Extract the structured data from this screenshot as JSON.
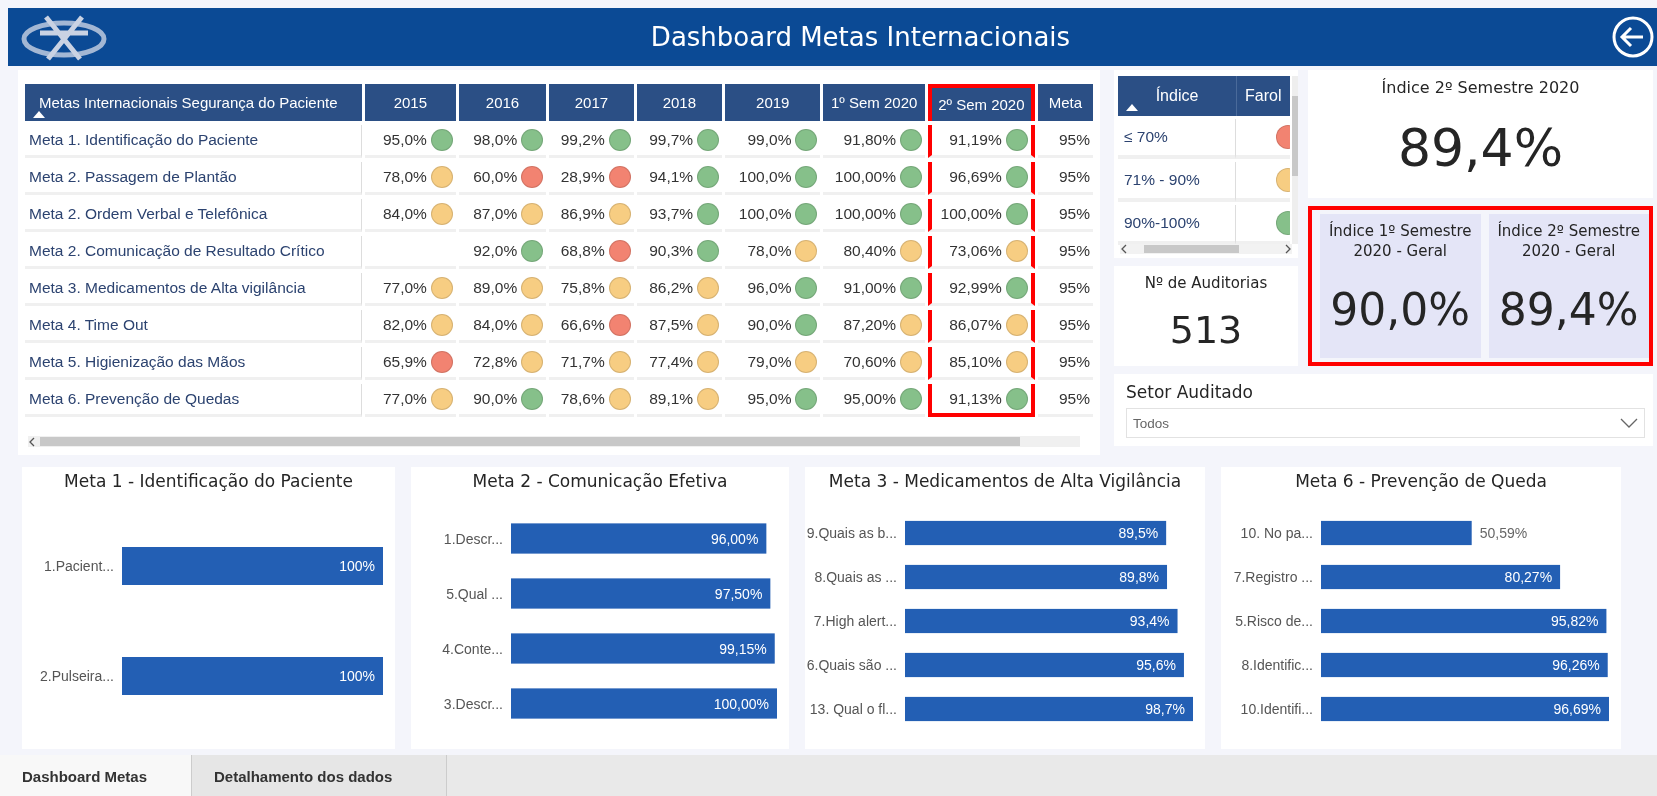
{
  "header": {
    "title": "Dashboard Metas Internacionais"
  },
  "table": {
    "columns": [
      {
        "label": "Metas Internacionais Segurança do Paciente",
        "highlighted": false
      },
      {
        "label": "2015",
        "highlighted": false
      },
      {
        "label": "2016",
        "highlighted": false
      },
      {
        "label": "2017",
        "highlighted": false
      },
      {
        "label": "2018",
        "highlighted": false
      },
      {
        "label": "2019",
        "highlighted": false
      },
      {
        "label": "1º Sem 2020",
        "highlighted": false
      },
      {
        "label": "2º Sem 2020",
        "highlighted": true
      },
      {
        "label": "Meta",
        "highlighted": false
      }
    ],
    "rows": [
      {
        "cells": [
          "Meta 1. Identificação do Paciente",
          {
            "value": "95,0%",
            "color": "#86c08a"
          },
          {
            "value": "98,0%",
            "color": "#86c08a"
          },
          {
            "value": "99,2%",
            "color": "#86c08a"
          },
          {
            "value": "99,7%",
            "color": "#86c08a"
          },
          {
            "value": "99,0%",
            "color": "#86c08a"
          },
          {
            "value": "91,80%",
            "color": "#86c08a"
          },
          {
            "value": "91,19%",
            "color": "#86c08a"
          },
          "95%"
        ]
      },
      {
        "cells": [
          "Meta 2. Passagem de Plantão",
          {
            "value": "78,0%",
            "color": "#f7cd82"
          },
          {
            "value": "60,0%",
            "color": "#f28371"
          },
          {
            "value": "28,9%",
            "color": "#f28371"
          },
          {
            "value": "94,1%",
            "color": "#86c08a"
          },
          {
            "value": "100,0%",
            "color": "#86c08a"
          },
          {
            "value": "100,00%",
            "color": "#86c08a"
          },
          {
            "value": "96,69%",
            "color": "#86c08a"
          },
          "95%"
        ]
      },
      {
        "cells": [
          "Meta 2. Ordem Verbal e Telefônica",
          {
            "value": "84,0%",
            "color": "#f7cd82"
          },
          {
            "value": "87,0%",
            "color": "#f7cd82"
          },
          {
            "value": "86,9%",
            "color": "#f7cd82"
          },
          {
            "value": "93,7%",
            "color": "#86c08a"
          },
          {
            "value": "100,0%",
            "color": "#86c08a"
          },
          {
            "value": "100,00%",
            "color": "#86c08a"
          },
          {
            "value": "100,00%",
            "color": "#86c08a"
          },
          "95%"
        ]
      },
      {
        "cells": [
          "Meta 2. Comunicação de Resultado Crítico",
          "",
          {
            "value": "92,0%",
            "color": "#86c08a"
          },
          {
            "value": "68,8%",
            "color": "#f28371"
          },
          {
            "value": "90,3%",
            "color": "#86c08a"
          },
          {
            "value": "78,0%",
            "color": "#f7cd82"
          },
          {
            "value": "80,40%",
            "color": "#f7cd82"
          },
          {
            "value": "73,06%",
            "color": "#f7cd82"
          },
          "95%"
        ]
      },
      {
        "cells": [
          "Meta 3. Medicamentos de Alta vigilância",
          {
            "value": "77,0%",
            "color": "#f7cd82"
          },
          {
            "value": "89,0%",
            "color": "#f7cd82"
          },
          {
            "value": "75,8%",
            "color": "#f7cd82"
          },
          {
            "value": "86,2%",
            "color": "#f7cd82"
          },
          {
            "value": "96,0%",
            "color": "#86c08a"
          },
          {
            "value": "91,00%",
            "color": "#86c08a"
          },
          {
            "value": "92,99%",
            "color": "#86c08a"
          },
          "95%"
        ]
      },
      {
        "cells": [
          "Meta 4. Time Out",
          {
            "value": "82,0%",
            "color": "#f7cd82"
          },
          {
            "value": "84,0%",
            "color": "#f7cd82"
          },
          {
            "value": "66,6%",
            "color": "#f28371"
          },
          {
            "value": "87,5%",
            "color": "#f7cd82"
          },
          {
            "value": "90,0%",
            "color": "#86c08a"
          },
          {
            "value": "87,20%",
            "color": "#f7cd82"
          },
          {
            "value": "86,07%",
            "color": "#f7cd82"
          },
          "95%"
        ]
      },
      {
        "cells": [
          "Meta 5. Higienização das Mãos",
          {
            "value": "65,9%",
            "color": "#f28371"
          },
          {
            "value": "72,8%",
            "color": "#f7cd82"
          },
          {
            "value": "71,7%",
            "color": "#f7cd82"
          },
          {
            "value": "77,4%",
            "color": "#f7cd82"
          },
          {
            "value": "79,0%",
            "color": "#f7cd82"
          },
          {
            "value": "70,60%",
            "color": "#f7cd82"
          },
          {
            "value": "85,10%",
            "color": "#f7cd82"
          },
          "95%"
        ]
      },
      {
        "cells": [
          "Meta 6. Prevenção de Quedas",
          {
            "value": "77,0%",
            "color": "#f7cd82"
          },
          {
            "value": "90,0%",
            "color": "#86c08a"
          },
          {
            "value": "78,6%",
            "color": "#f7cd82"
          },
          {
            "value": "89,1%",
            "color": "#f7cd82"
          },
          {
            "value": "95,0%",
            "color": "#86c08a"
          },
          {
            "value": "95,00%",
            "color": "#86c08a"
          },
          {
            "value": "91,13%",
            "color": "#86c08a"
          },
          "95%"
        ]
      }
    ]
  },
  "legend": {
    "columns": [
      "Índice",
      "Farol"
    ],
    "rows": [
      {
        "label": "≤ 70%",
        "color": "#f28371"
      },
      {
        "label": "71% - 90%",
        "color": "#f7cd82"
      },
      {
        "label": "90%-100%",
        "color": "#86c08a"
      }
    ]
  },
  "kpi_top": {
    "title": "Índice 2º Semestre 2020",
    "value": "89,4%"
  },
  "audits": {
    "title": "Nº de Auditorias",
    "value": "513"
  },
  "kpi_pair": {
    "highlighted": true,
    "cards": [
      {
        "title": "Índice 1º Semestre 2020 - Geral",
        "value": "90,0%"
      },
      {
        "title": "Índice 2º Semestre 2020 - Geral",
        "value": "89,4%"
      }
    ]
  },
  "slicer": {
    "label": "Setor Auditado",
    "value": "Todos"
  },
  "charts": [
    {
      "chart_data": {
        "type": "bar",
        "orientation": "horizontal",
        "title": "Meta 1 - Identificação do Paciente",
        "categories": [
          "1.Pacient...",
          "2.Pulseira..."
        ],
        "values": [
          100,
          100
        ],
        "value_labels": [
          "100%",
          "100%"
        ]
      }
    },
    {
      "chart_data": {
        "type": "bar",
        "orientation": "horizontal",
        "title": "Meta 2 - Comunicação Efetiva",
        "categories": [
          "1.Descr...",
          "5.Qual ...",
          "4.Conte...",
          "3.Descr..."
        ],
        "values": [
          96,
          97.5,
          99.15,
          100
        ],
        "value_labels": [
          "96,00%",
          "97,50%",
          "99,15%",
          "100,00%"
        ]
      }
    },
    {
      "chart_data": {
        "type": "bar",
        "orientation": "horizontal",
        "title": "Meta 3 - Medicamentos de Alta Vigilância",
        "categories": [
          "9.Quais as b...",
          "8.Quais as ...",
          "7.High alert...",
          "6.Quais são ...",
          "13. Qual o fl..."
        ],
        "values": [
          89.5,
          89.8,
          93.4,
          95.6,
          98.7
        ],
        "value_labels": [
          "89,5%",
          "89,8%",
          "93,4%",
          "95,6%",
          "98,7%"
        ]
      }
    },
    {
      "chart_data": {
        "type": "bar",
        "orientation": "horizontal",
        "title": "Meta 6 - Prevenção de Queda",
        "categories": [
          "10. No pa...",
          "7.Registro ...",
          "5.Risco de...",
          "8.Identific...",
          "10.Identifi..."
        ],
        "values": [
          50.59,
          80.27,
          95.82,
          96.26,
          96.69
        ],
        "value_labels": [
          "50,59%",
          "80,27%",
          "95,82%",
          "96,26%",
          "96,69%"
        ]
      }
    }
  ],
  "tabs": [
    {
      "label": "Dashboard Metas",
      "selected": true
    },
    {
      "label": "Detalhamento dos dados",
      "selected": false
    }
  ]
}
